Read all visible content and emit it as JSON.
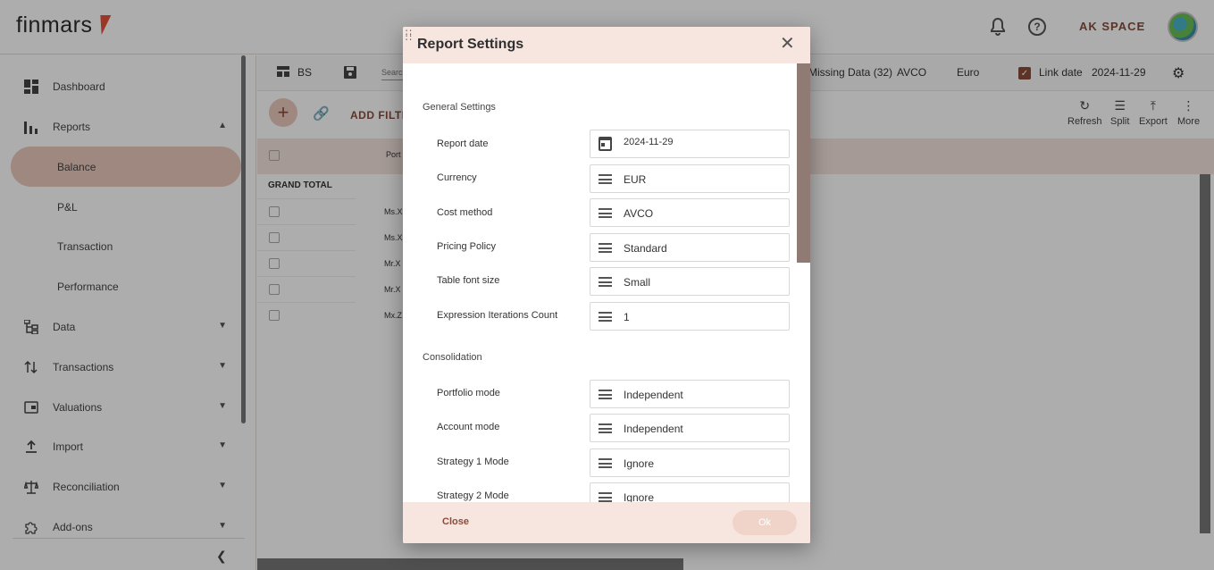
{
  "app": {
    "logo_text": "finmars",
    "space_name": "AK SPACE"
  },
  "sidebar": {
    "items": [
      {
        "label": "Dashboard",
        "icon": "dashboard-icon"
      },
      {
        "label": "Reports",
        "icon": "bar-chart-icon",
        "expanded": true
      },
      {
        "label": "Data",
        "icon": "data-tree-icon"
      },
      {
        "label": "Transactions",
        "icon": "transactions-icon"
      },
      {
        "label": "Valuations",
        "icon": "wallet-icon"
      },
      {
        "label": "Import",
        "icon": "upload-icon"
      },
      {
        "label": "Reconciliation",
        "icon": "scale-icon"
      },
      {
        "label": "Add-ons",
        "icon": "puzzle-icon"
      }
    ],
    "report_subitems": [
      {
        "label": "Balance",
        "active": true
      },
      {
        "label": "P&L"
      },
      {
        "label": "Transaction"
      },
      {
        "label": "Performance"
      }
    ]
  },
  "report_toolbar": {
    "layout_name": "BS",
    "search_placeholder": "Search",
    "missing_data": "Missing Data (32)",
    "cost_method": "AVCO",
    "currency": "Euro",
    "link_date_label": "Link date",
    "link_date_checked": true,
    "date": "2024-11-29",
    "add_filter_label": "ADD FILTER",
    "actions": [
      {
        "label": "Refresh",
        "icon": "refresh-icon"
      },
      {
        "label": "Split",
        "icon": "split-icon"
      },
      {
        "label": "Export",
        "icon": "export-icon"
      },
      {
        "label": "More",
        "icon": "more-vertical-icon"
      }
    ]
  },
  "report_grid": {
    "column_header": "Port",
    "grand_total_label": "GRAND TOTAL",
    "rows": [
      "Ms.X",
      "Ms.X",
      "Mr.X",
      "Mr.X",
      "Mx.Z"
    ]
  },
  "dialog": {
    "title": "Report Settings",
    "general_section": "General Settings",
    "general_fields": [
      {
        "label": "Report date",
        "value": "2024-11-29",
        "icon": "calendar-icon"
      },
      {
        "label": "Currency",
        "value": "EUR",
        "icon": "menu-icon"
      },
      {
        "label": "Cost method",
        "value": "AVCO",
        "icon": "menu-icon"
      },
      {
        "label": "Pricing Policy",
        "value": "Standard",
        "icon": "menu-icon"
      },
      {
        "label": "Table font size",
        "value": "Small",
        "icon": "menu-icon"
      },
      {
        "label": "Expression Iterations Count",
        "value": "1",
        "icon": "menu-icon"
      }
    ],
    "consolidation_section": "Consolidation",
    "consolidation_fields": [
      {
        "label": "Portfolio mode",
        "value": "Independent"
      },
      {
        "label": "Account mode",
        "value": "Independent"
      },
      {
        "label": "Strategy 1 Mode",
        "value": "Ignore"
      },
      {
        "label": "Strategy 2 Mode",
        "value": "Ignore"
      }
    ],
    "close_label": "Close",
    "ok_label": "Ok"
  },
  "colors": {
    "accent": "#8a4b3a",
    "accent_light": "#e9c9bd",
    "header_tint": "#f7e6e0",
    "logo_mark": "#e8503a"
  }
}
